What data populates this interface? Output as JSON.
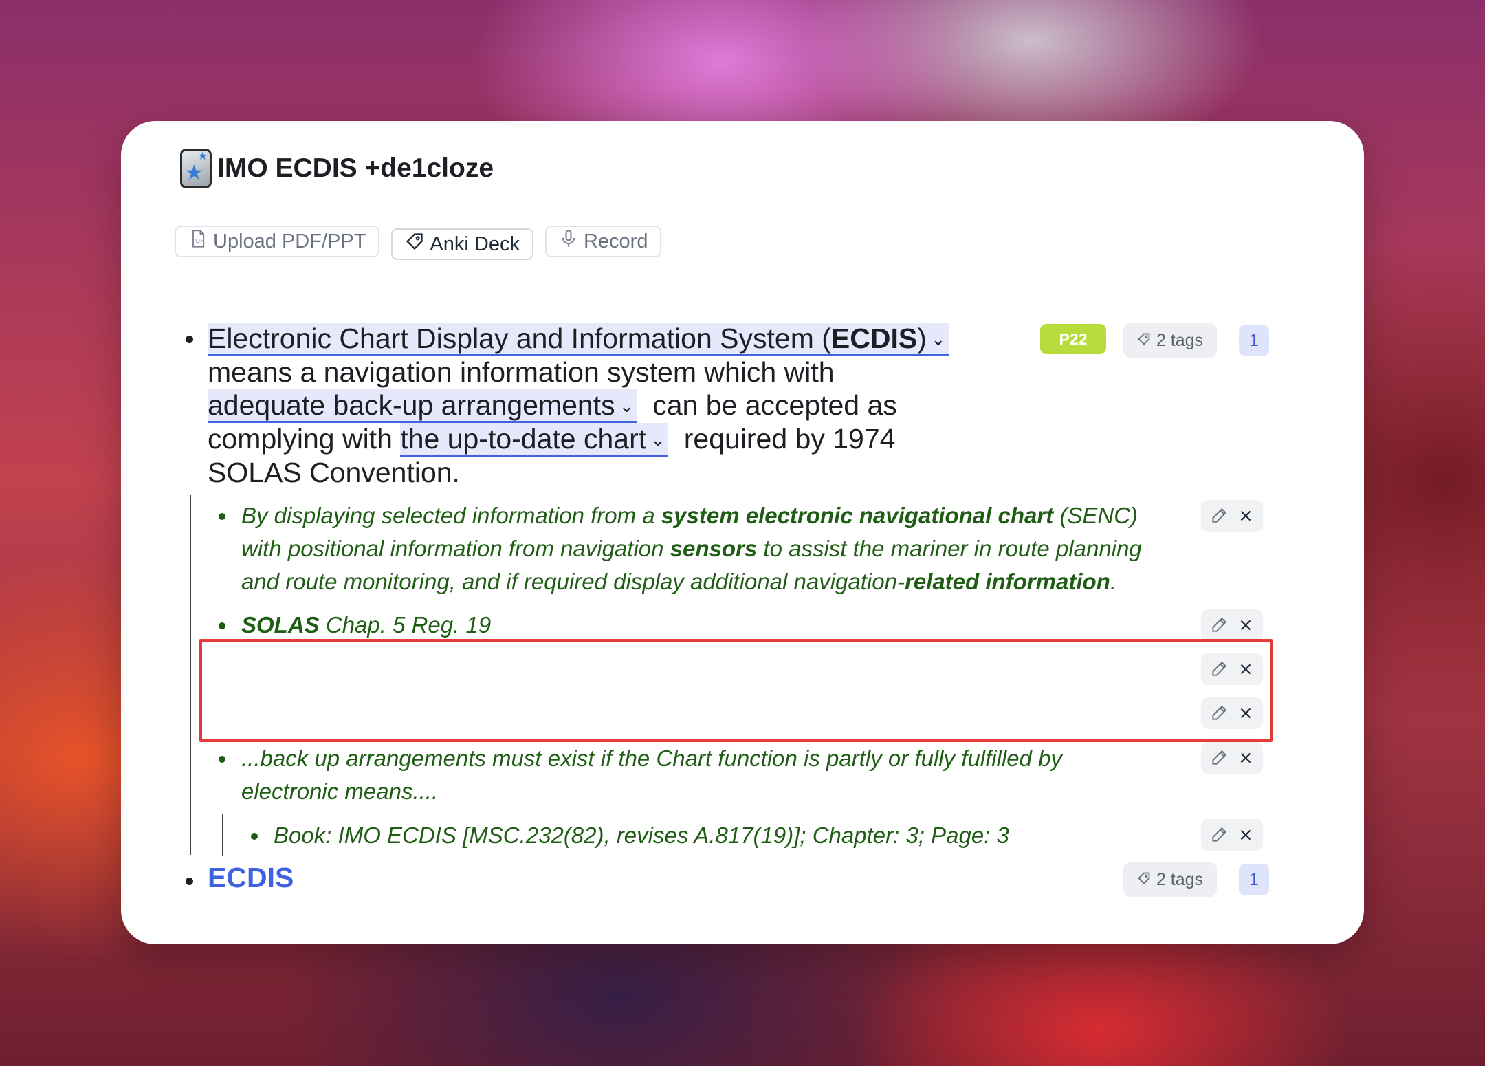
{
  "deck": {
    "title": "IMO ECDIS +de1cloze",
    "icon": "anki-star-icon"
  },
  "toolbar": {
    "upload_label": "Upload PDF/PPT",
    "anki_label": "Anki Deck",
    "record_label": "Record"
  },
  "main_note": {
    "cloze1_pre": "Electronic Chart Display and Information System (",
    "cloze1_bold": "ECDIS",
    "cloze1_post": ")",
    "text1": "means a navigation information system which with",
    "cloze2": "adequate back-up arrangements",
    "text2": "can be accepted as",
    "text3": "complying with",
    "cloze3": "the up-to-date chart",
    "text4": "required by 1974",
    "text5": "SOLAS Convention.",
    "page_badge": "P22",
    "tags_label": "2 tags",
    "count": "1"
  },
  "sub_notes": {
    "n1_a": "By displaying selected information from a ",
    "n1_b": "system electronic navigational chart",
    "n1_c": " (SENC)",
    "n1_d": "with positional information from navigation ",
    "n1_e": "sensors",
    "n1_f": " to assist the mariner in route planning",
    "n1_g": "and route monitoring, and if required display additional navigation-",
    "n1_h": "related information",
    "n1_i": ".",
    "n2_a": "SOLAS",
    "n2_b": " Chap. 5 Reg. 19",
    "n3_a": "...back up arrangements must exist if the Chart function is partly or fully fulfilled by",
    "n3_b": "electronic means....",
    "n4": "Book: IMO ECDIS [MSC.232(82), revises A.817(19)]; Chapter: 3; Page: 3"
  },
  "second_note": {
    "label": "ECDIS",
    "tags_label": "2 tags",
    "count": "1"
  },
  "colors": {
    "accent": "#3f63e0",
    "note_green": "#1f5d15",
    "badge_green": "#b8dc3b",
    "highlight_red": "#e53b3b"
  }
}
